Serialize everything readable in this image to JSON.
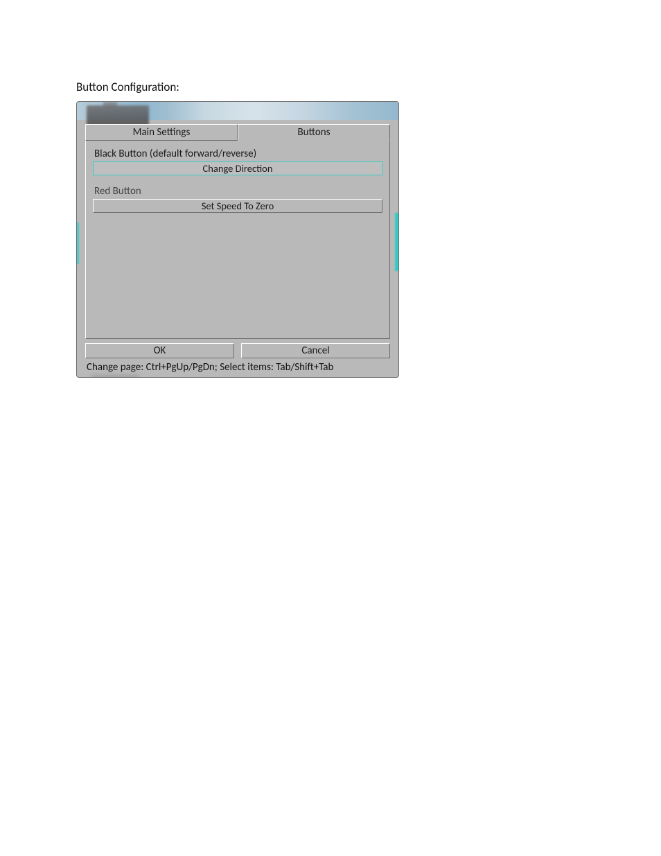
{
  "page": {
    "heading": "Button Configuration:"
  },
  "dialog": {
    "tabs": {
      "main_settings": "Main Settings",
      "buttons": "Buttons"
    },
    "groups": {
      "black_button": {
        "label": "Black Button (default forward/reverse)",
        "value": "Change Direction"
      },
      "red_button": {
        "label": "Red Button",
        "value": "Set Speed To Zero"
      }
    },
    "actions": {
      "ok": "OK",
      "cancel": "Cancel"
    },
    "status": "Change page: Ctrl+PgUp/PgDn; Select items: Tab/Shift+Tab"
  }
}
